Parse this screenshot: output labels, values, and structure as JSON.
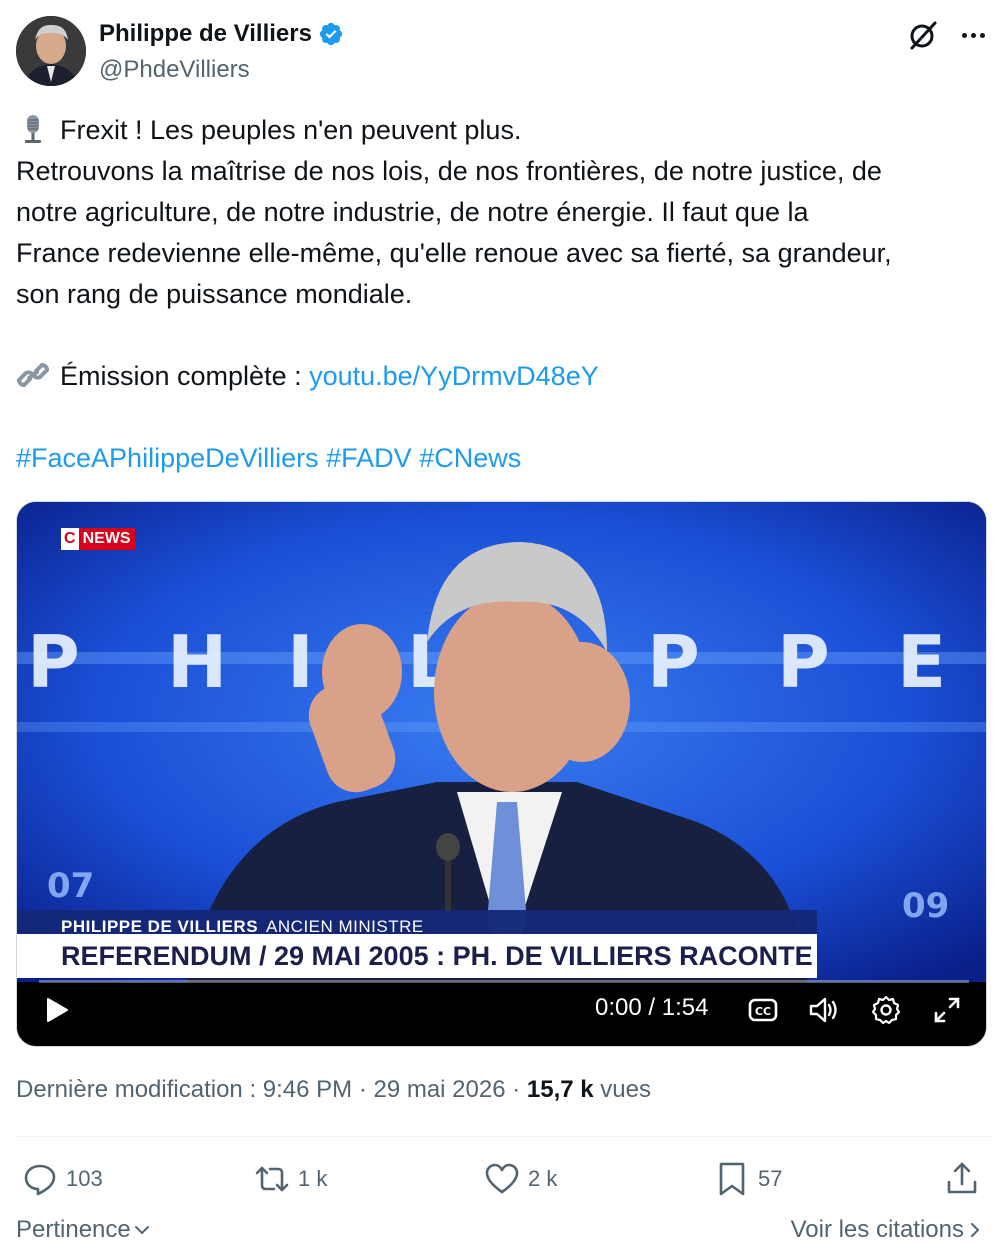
{
  "author": {
    "display_name": "Philippe de Villiers",
    "handle": "@PhdeVilliers",
    "verified": true
  },
  "icons": {
    "avatar": "avatar-portrait",
    "verified": "verified-badge-icon",
    "grok": "grok-icon",
    "more": "more-options-icon"
  },
  "tweet": {
    "line1": "Frexit ! Les peuples n'en peuvent plus.",
    "line2": "Retrouvons la maîtrise de nos lois, de nos frontières, de notre justice, de",
    "line3": "notre agriculture, de notre industrie, de notre énergie. Il faut que la",
    "line4": "France redevienne elle-même, qu'elle renoue avec sa fierté, sa grandeur,",
    "line5": "son rang de puissance mondiale.",
    "emission_label": "Émission complète : ",
    "emission_link": "youtu.be/YyDrmvD48eY",
    "hashtags": "#FaceAPhilippeDeVilliers #FADV #CNews"
  },
  "video": {
    "channel_c": "C",
    "channel_news": "NEWS",
    "lower_third_name": "PHILIPPE DE VILLIERS",
    "lower_third_role": "ANCIEN MINISTRE",
    "lower_third_title": "REFERENDUM / 29 MAI 2005 : PH. DE VILLIERS RACONTE",
    "time": "0:00 / 1:54",
    "progress": 0,
    "backdrop_letters": [
      "P",
      "H",
      "I",
      "L",
      "I",
      "P",
      "P",
      "E"
    ]
  },
  "meta": {
    "prefix": "Dernière modification : 9:46 PM · 29 mai 2026 · ",
    "views_count": "15,7 k",
    "views_label": " vues"
  },
  "actions": {
    "replies": "103",
    "reposts": "1 k",
    "likes": "2 k",
    "bookmarks": "57"
  },
  "footer": {
    "sort_label": "Pertinence",
    "quotes_label": "Voir les citations"
  },
  "colors": {
    "accent": "#1d9bf0",
    "text": "#0f1419",
    "secondary": "#536471",
    "cnews_red": "#d9001b"
  }
}
